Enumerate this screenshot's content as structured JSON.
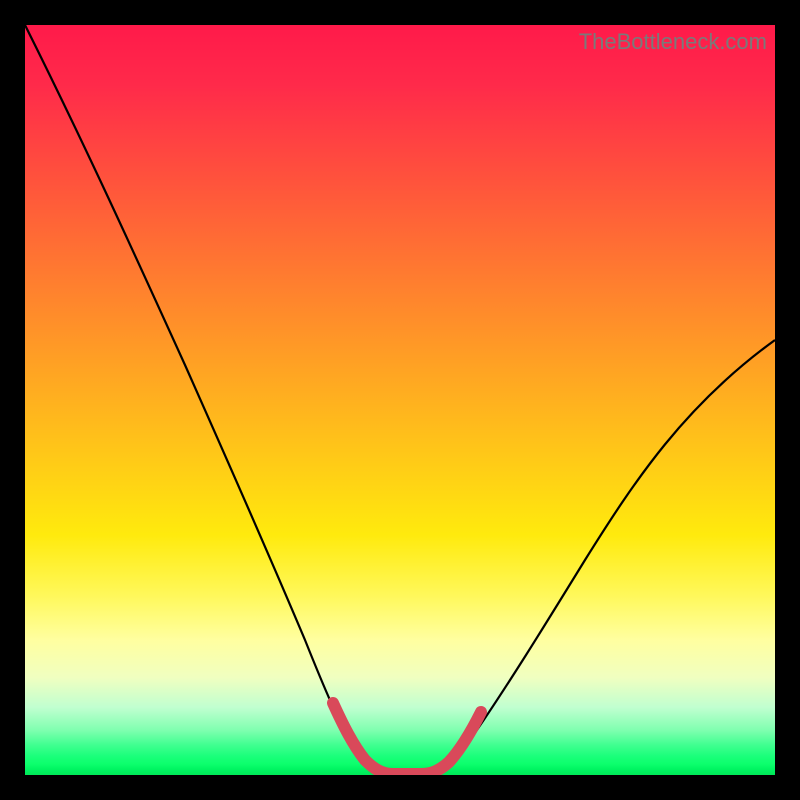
{
  "watermark": "TheBottleneck.com",
  "chart_data": {
    "type": "line",
    "title": "",
    "xlabel": "",
    "ylabel": "",
    "xlim": [
      0,
      100
    ],
    "ylim": [
      0,
      100
    ],
    "series": [
      {
        "name": "bottleneck-curve",
        "color": "#000000",
        "x": [
          0,
          5,
          10,
          15,
          20,
          25,
          30,
          35,
          38,
          40,
          42,
          44,
          46,
          48,
          50,
          55,
          60,
          65,
          70,
          75,
          80,
          85,
          90,
          95,
          100
        ],
        "y": [
          100,
          90,
          79,
          68,
          57,
          46,
          35,
          23,
          15,
          10,
          6,
          3,
          1,
          0,
          0,
          1,
          4,
          9,
          15,
          22,
          29,
          36,
          44,
          51,
          58
        ]
      },
      {
        "name": "optimal-range-marker",
        "color": "#d9495a",
        "x": [
          40,
          42,
          44,
          46,
          48,
          50,
          52,
          54,
          56
        ],
        "y": [
          10,
          5,
          2,
          1,
          0,
          0,
          1,
          3,
          8
        ]
      }
    ],
    "notes": "V-shaped bottleneck curve on rainbow gradient; left branch reaches the top-left, right branch rises to about 58% at the right edge. Thick salmon marker traces the trough between x≈40 and x≈56."
  }
}
